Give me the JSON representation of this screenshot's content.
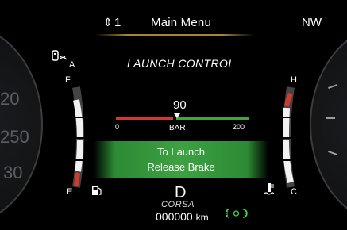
{
  "top_bar": {
    "menu_arrow": "⇕",
    "menu_number": "1",
    "title": "Main Menu",
    "compass": "NW"
  },
  "left_dial": {
    "numbers": [
      "20",
      "250",
      "30"
    ]
  },
  "fuel_gauge": {
    "full_label": "F",
    "empty_label": "E",
    "icon": "fuel-pump-icon",
    "top_icon": "key-fob-icon"
  },
  "temp_gauge": {
    "hot_label": "H",
    "cold_label": "C",
    "icon": "coolant-temp-icon"
  },
  "launch": {
    "title": "LAUNCH CONTROL",
    "boost_value": "90",
    "scale_min": "0",
    "scale_unit": "BAR",
    "scale_max": "200",
    "banner_line1": "To Launch",
    "banner_line2": "Release Brake"
  },
  "drive": {
    "gear": "D",
    "mode": "CORSA",
    "odometer": "000000",
    "odometer_unit": "km"
  },
  "indicators": {
    "parking_lights_icon": "parking-lights-icon"
  },
  "colors": {
    "accent_line": "#c09040",
    "banner_green": "#3da142",
    "redline": "#d03a2f",
    "greenline": "#46a33b",
    "indicator_green": "#3fd44a"
  }
}
